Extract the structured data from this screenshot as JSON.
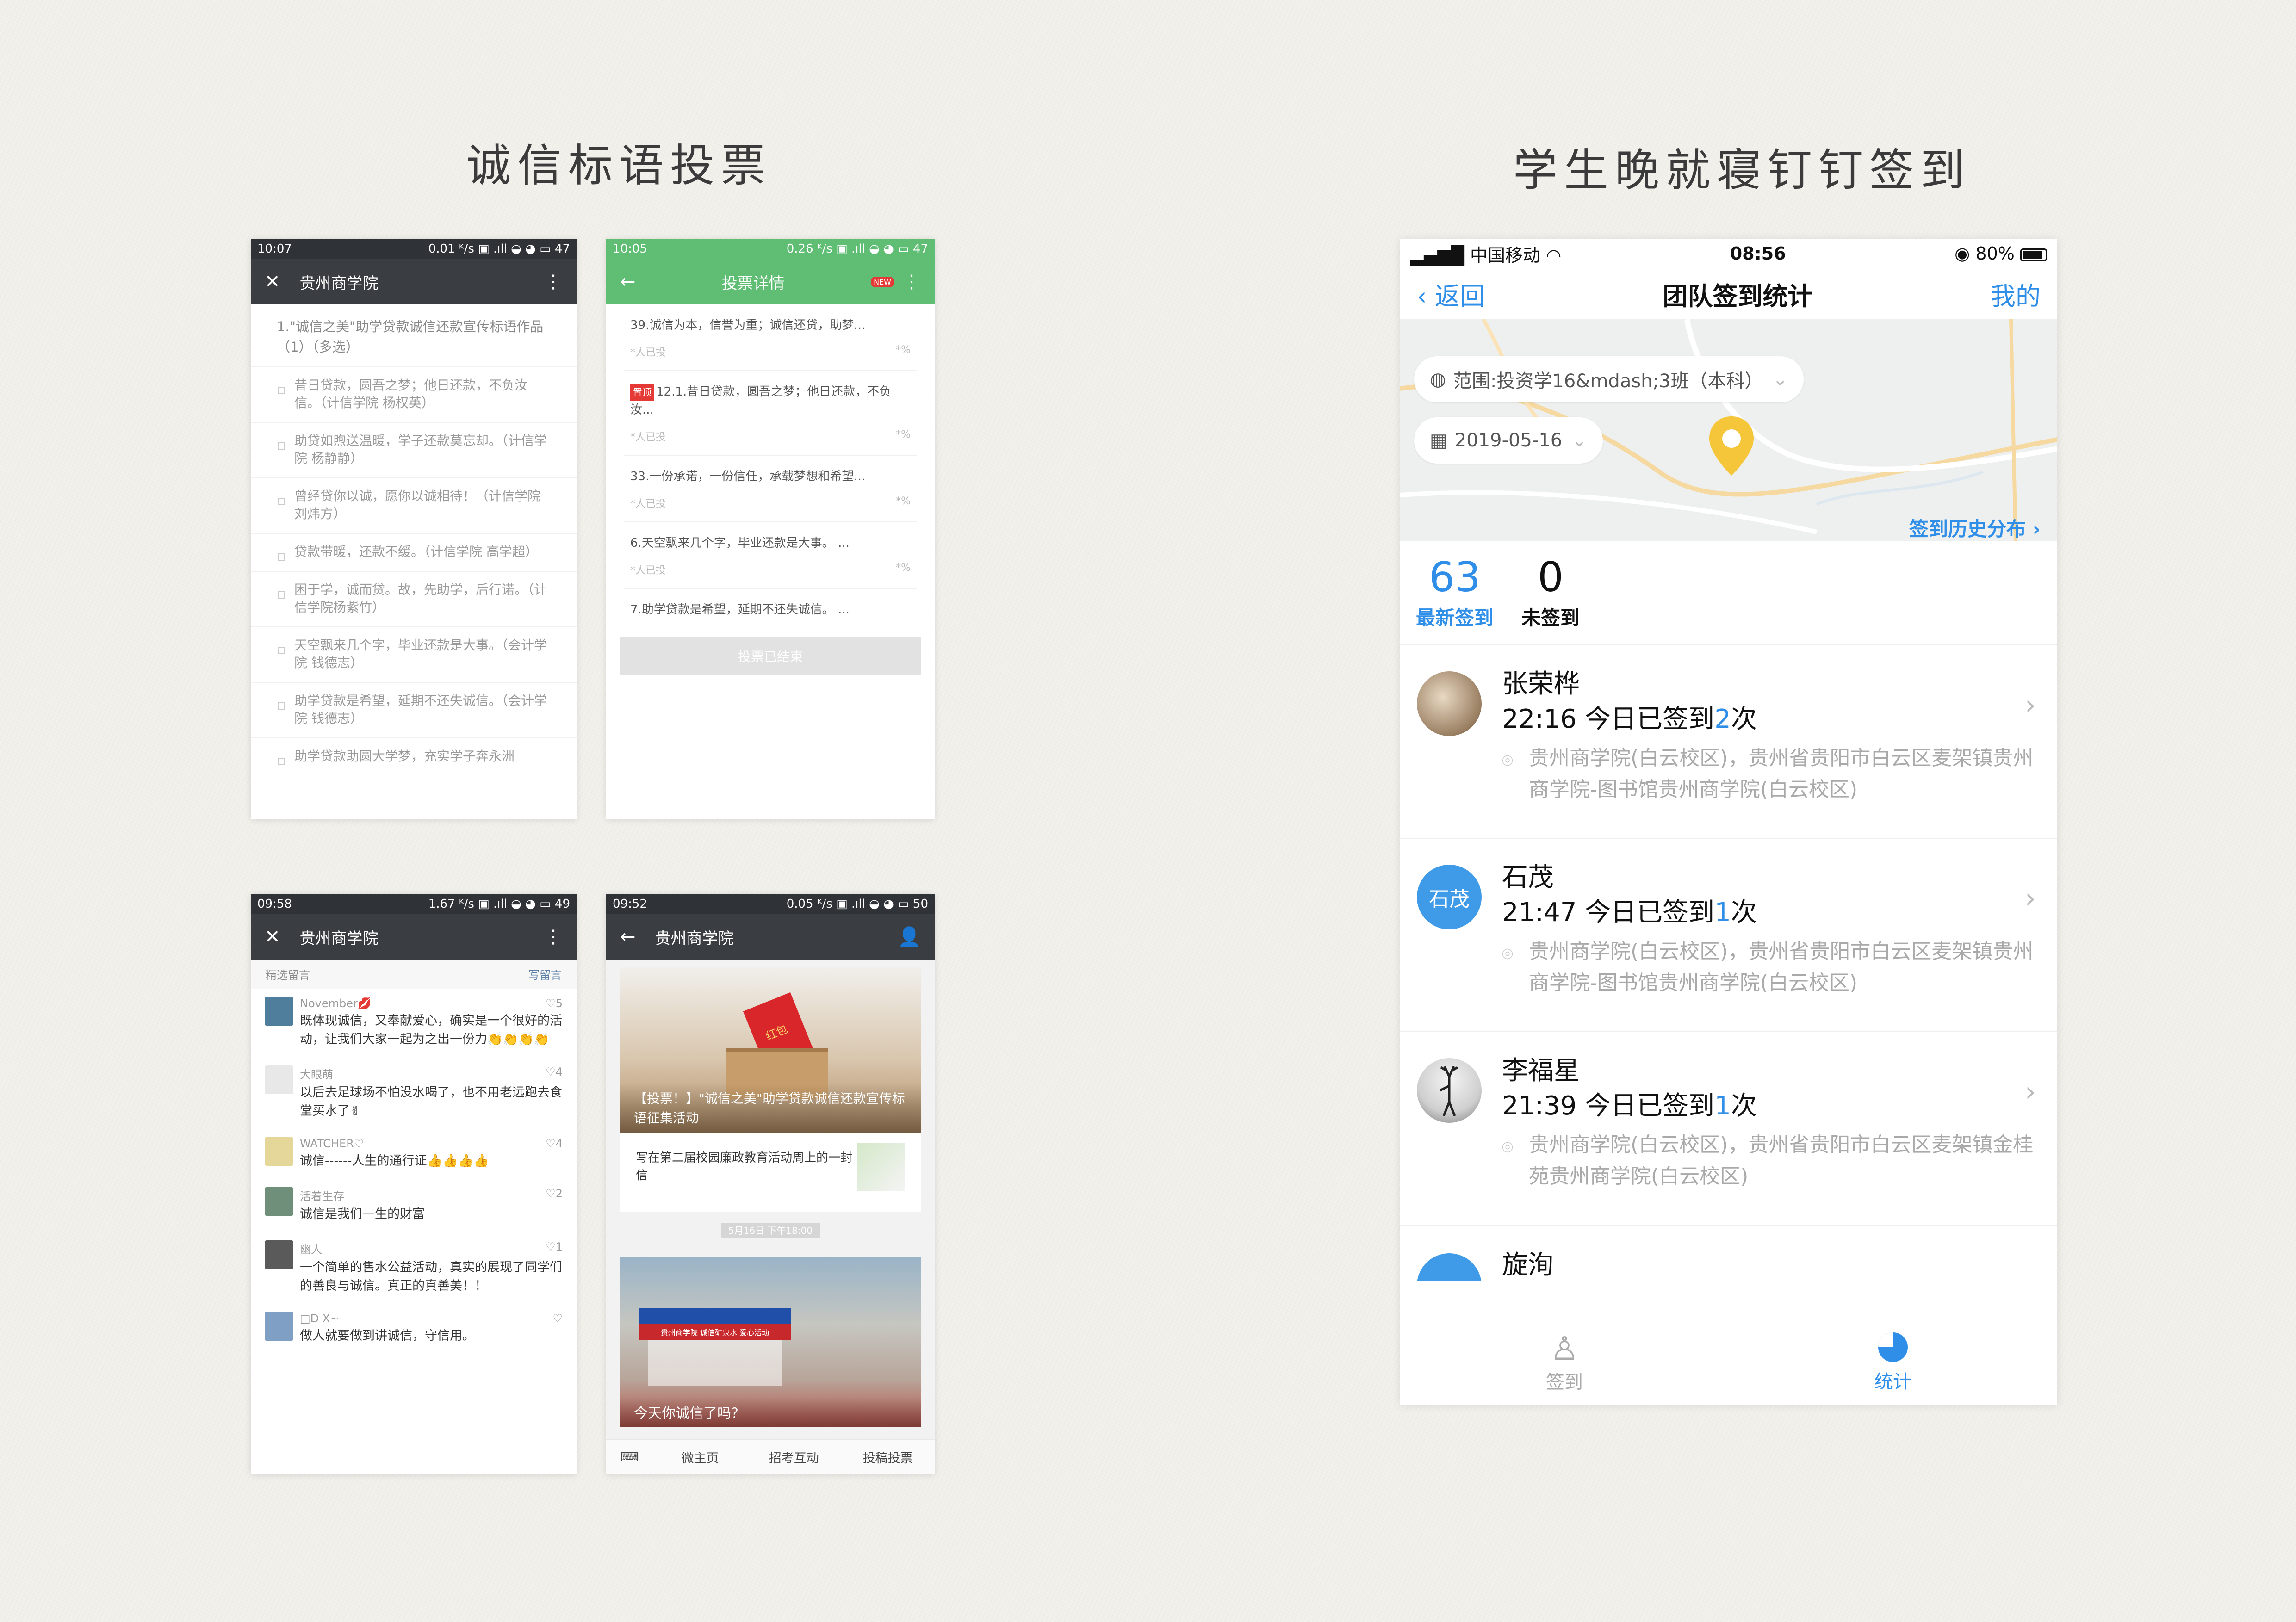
{
  "left_title": "诚信标语投票",
  "right_title": "学生晚就寝钉钉签到",
  "phone1": {
    "status_time": "10:07",
    "status_right": "0.01 ᴷ/s ▣ .ıll ◒ ◕ ▭ 47",
    "title": "贵州商学院",
    "question": "1.\"诚信之美\"助学贷款诚信还款宣传标语作品（1）（多选）",
    "options": [
      "昔日贷款，圆吾之梦；他日还款，不负汝信。（计信学院 杨权英）",
      "助贷如煦送温暖，学子还款莫忘却。（计信学院 杨静静）",
      "曾经贷你以诚，愿你以诚相待！（计信学院 刘炜方）",
      "贷款带暖，还款不缓。（计信学院 高学超）",
      "困于学，诚而贷。故，先助学，后行诺。（计信学院杨紫竹）",
      "天空飘来几个字，毕业还款是大事。（会计学院 钱德志）",
      "助学贷款是希望，延期不还失诚信。（会计学院 钱德志）",
      "助学贷款助圆大学梦，充实学子奔永洲"
    ]
  },
  "phone2": {
    "status_time": "10:05",
    "status_right": "0.26 ᴷ/s ▣ .ıll ◒ ◕ ▭ 47",
    "title": "投票详情",
    "new_badge": "NEW",
    "tag": "置顶",
    "items": [
      {
        "text": "39.诚信为本，信誉为重；诚信还贷，助梦...",
        "meta": "*人已投",
        "pct": "*%"
      },
      {
        "text": "12.1.昔日贷款，圆吾之梦；他日还款，不负汝...",
        "meta": "*人已投",
        "pct": "*%"
      },
      {
        "text": "33.一份承诺，一份信任，承载梦想和希望...",
        "meta": "*人已投",
        "pct": "*%"
      },
      {
        "text": "6.天空飘来几个字，毕业还款是大事。 ...",
        "meta": "*人已投",
        "pct": "*%"
      },
      {
        "text": "7.助学贷款是希望，延期不还失诚信。 ...",
        "meta": "",
        "pct": ""
      }
    ],
    "end_button": "投票已结束"
  },
  "phone3": {
    "status_time": "09:58",
    "status_right": "1.67 ᴷ/s ▣ .ıll ◒ ◕ ▭ 49",
    "title": "贵州商学院",
    "head_left": "精选留言",
    "head_right": "写留言",
    "comments": [
      {
        "name": "November💋",
        "likes": "♡5",
        "text": "既体现诚信，又奉献爱心，确实是一个很好的活动，让我们大家一起为之出一份力👏👏👏👏"
      },
      {
        "name": "大眼萌",
        "likes": "♡4",
        "text": "以后去足球场不怕没水喝了，也不用老远跑去食堂买水了✌"
      },
      {
        "name": "WATCHER♡",
        "likes": "♡4",
        "text": "诚信------人生的通行证👍👍👍👍"
      },
      {
        "name": "活着生存",
        "likes": "♡2",
        "text": "诚信是我们一生的财富"
      },
      {
        "name": "幽人",
        "likes": "♡1",
        "text": "一个简单的售水公益活动，真实的展现了同学们的善良与诚信。真正的真善美！！"
      },
      {
        "name": "□D X~",
        "likes": "♡",
        "text": "做人就要做到讲诚信，守信用。"
      }
    ]
  },
  "phone4": {
    "status_time": "09:52",
    "status_right": "0.05 ᴷ/s ▣ .ıll ◒ ◕ ▭ 50",
    "title": "贵州商学院",
    "hero_caption": "【投票！】\"诚信之美\"助学贷款诚信还款宣传标语征集活动",
    "hero_sign": "红包",
    "article": "写在第二届校园廉政教育活动周上的一封信",
    "timestamp": "5月16日 下午18:00",
    "tent_banner": "贵州商学院  诚信矿泉水  爱心活动",
    "hero2_caption": "今天你诚信了吗？",
    "tabs": [
      "微主页",
      "招考互动",
      "投稿投票"
    ]
  },
  "phone5": {
    "carrier": "中国移动",
    "time": "08:56",
    "battery": "80%",
    "back": "返回",
    "title": "团队签到统计",
    "mine": "我的",
    "scope": "范围:投资学16&mdash;3班（本科）",
    "date": "2019-05-16",
    "history": "签到历史分布",
    "stat1_num": "63",
    "stat1_label": "最新签到",
    "stat2_num": "0",
    "stat2_label": "未签到",
    "records": [
      {
        "name": "张荣桦",
        "time": "22:16 今日已签到",
        "count": "2",
        "unit": "次",
        "addr": "贵州商学院(白云校区)，贵州省贵阳市白云区麦架镇贵州商学院-图书馆贵州商学院(白云校区)"
      },
      {
        "name": "石茂",
        "avatar_text": "石茂",
        "time": "21:47 今日已签到",
        "count": "1",
        "unit": "次",
        "addr": "贵州商学院(白云校区)，贵州省贵阳市白云区麦架镇贵州商学院-图书馆贵州商学院(白云校区)"
      },
      {
        "name": "李福星",
        "time": "21:39 今日已签到",
        "count": "1",
        "unit": "次",
        "addr": "贵州商学院(白云校区)，贵州省贵阳市白云区麦架镇金桂苑贵州商学院(白云校区)"
      }
    ],
    "partial_name": "旋洵",
    "tab_signin": "签到",
    "tab_stats": "统计"
  },
  "colors": {
    "accent_blue": "#2f8ee8",
    "green": "#5fbe74",
    "dark_bar": "#3a3d42",
    "map_pin": "#f5c53a"
  }
}
